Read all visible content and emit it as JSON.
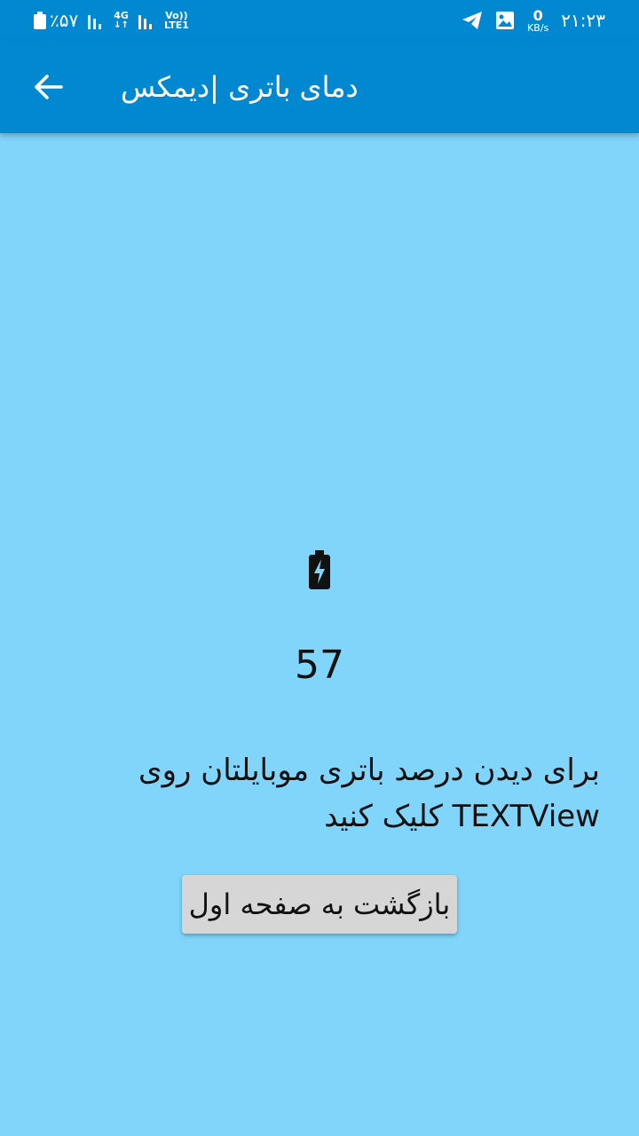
{
  "status_bar": {
    "battery_percent": "٪۵۷",
    "network_4g": "4G",
    "volte_line1": "Vo))",
    "volte_line2": "LTE1",
    "speed_value": "0",
    "speed_unit": "KB/s",
    "time": "۲۱:۲۳",
    "icons": [
      "battery-icon",
      "signal-icon",
      "signal-icon",
      "telegram-icon",
      "image-icon"
    ]
  },
  "app_bar": {
    "back_icon": "arrow-back-icon",
    "title": "دمای باتری |دیمکس"
  },
  "main": {
    "battery_icon": "battery-charging-icon",
    "battery_value": "57",
    "instruction": "برای دیدن درصد باتری موبایلتان روی TEXTView کلیک کنید",
    "back_home_button": "بازگشت به صفحه اول"
  },
  "colors": {
    "background": "#81d4fa",
    "app_bar": "#0288d1",
    "button": "#d6d6d6",
    "text": "#111111"
  }
}
